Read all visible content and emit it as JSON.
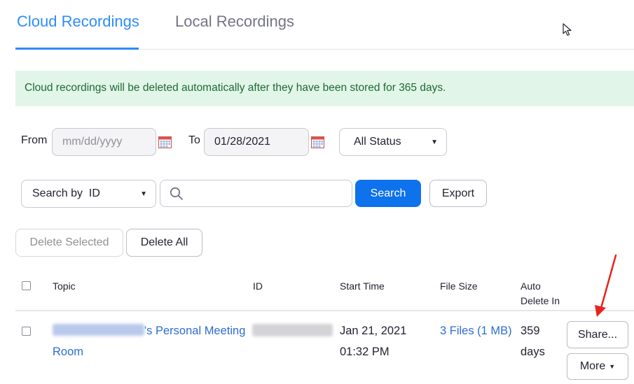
{
  "tabs": {
    "cloud": "Cloud Recordings",
    "local": "Local Recordings"
  },
  "notice": "Cloud recordings will be deleted automatically after they have been stored for 365 days.",
  "filters": {
    "from_label": "From",
    "from_placeholder": "mm/dd/yyyy",
    "to_label": "To",
    "to_value": "01/28/2021",
    "status_value": "All Status",
    "search_by_value": "Search by  ID",
    "search_button": "Search",
    "export_button": "Export"
  },
  "actions": {
    "delete_selected": "Delete Selected",
    "delete_all": "Delete All"
  },
  "table": {
    "headers": {
      "topic": "Topic",
      "id": "ID",
      "start_time": "Start Time",
      "file_size": "File Size",
      "auto_delete_line1": "Auto",
      "auto_delete_line2": "Delete In"
    },
    "rows": [
      {
        "topic_suffix": "'s Personal Meeting",
        "topic_line2": "Room",
        "start_date": "Jan 21, 2021",
        "start_time": "01:32 PM",
        "file_size": "3 Files (1 MB)",
        "auto_delete_num": "359",
        "auto_delete_unit": "days",
        "share_button": "Share...",
        "more_button": "More"
      }
    ]
  },
  "colors": {
    "accent": "#2d8cff",
    "primary_button": "#0e72ed",
    "notice_bg": "#e2f5e9",
    "notice_text": "#1e6a33",
    "annotation_arrow": "#e8231c"
  }
}
